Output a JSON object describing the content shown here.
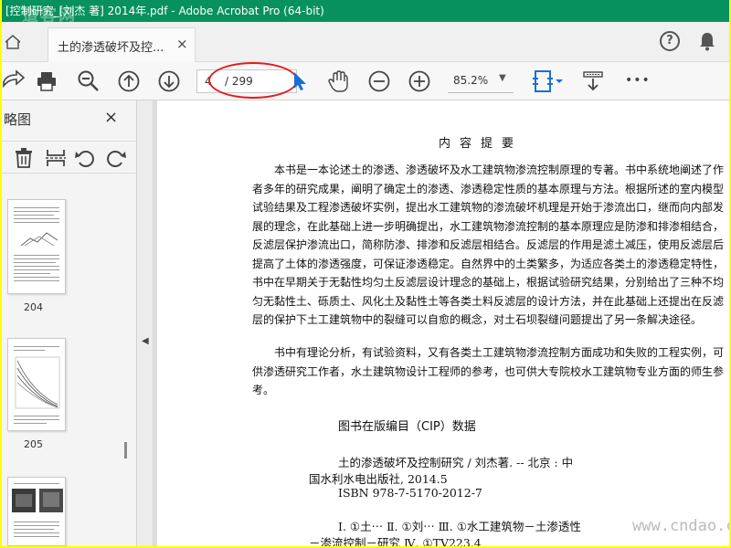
{
  "window": {
    "title": "[控制研究_[刘杰 著] 2014年.pdf - Adobe Acrobat Pro (64-bit)",
    "watermark_top": "道客网"
  },
  "tabbar": {
    "doc_tab_label": "土的渗透破坏及控...",
    "close_glyph": "×",
    "help_glyph": "?"
  },
  "toolbar": {
    "current_page": "4",
    "total_pages": "/ 299",
    "zoom": "85.2%",
    "more_glyph": "•••"
  },
  "sidebar": {
    "title": "略图",
    "close_glyph": "×",
    "thumbnails": [
      {
        "label": "204"
      },
      {
        "label": "205"
      },
      {
        "label": ""
      }
    ]
  },
  "document": {
    "summary_title": "内容提要",
    "para1": "本书是一本论述土的渗透、渗透破坏及水工建筑物渗流控制原理的专著。书中系统地阐述了作者多年的研究成果，阐明了确定土的渗透、渗透稳定性质的基本原理与方法。根据所述的室内模型试验结果及工程渗透破坏实例，提出水工建筑物的渗流破坏机理是开始于渗流出口，继而向内部发展的理念，在此基础上进一步明确提出，水工建筑物渗流控制的基本原理应是防渗和排渗相结合，反滤层保护渗流出口，简称防渗、排渗和反滤层相结合。反滤层的作用是滤土减压，使用反滤层后提高了土体的渗透强度，可保证渗透稳定。自然界中的土类繁多，为适应各类土的渗透稳定特性，书中在早期关于无黏性均匀土反滤层设计理念的基础上，根据试验研究结果，分别给出了三种不均匀无黏性土、砾质土、风化土及黏性土等各类土料反滤层的设计方法，并在此基础上还提出在反滤层的保护下土工建筑物中的裂缝可以自愈的概念，对土石坝裂缝问题提出了另一条解决途径。",
    "para2": "书中有理论分析，有试验资料，又有各类土工建筑物渗流控制方面成功和失败的工程实例，可供渗透研究工作者，水土建筑物设计工程师的参考，也可供大专院校水工建筑物专业方面的师生参考。",
    "cip_title": "图书在版编目（CIP）数据",
    "cip_line1": "土的渗透破坏及控制研究 / 刘杰著. -- 北京 : 中",
    "cip_line2": "国水利水电出版社, 2014.5",
    "cip_line3": "ISBN 978-7-5170-2012-7",
    "cip_line4": "Ⅰ. ①土⋯ Ⅱ. ①刘⋯ Ⅲ. ①水工建筑物－土渗透性",
    "cip_line5": "－渗流控制－研究 Ⅳ. ①TV223.4"
  },
  "overlay": {
    "watermark_bottom": "www.cndao.com"
  },
  "colors": {
    "titlebar": "#07915e",
    "annotation_red": "#e21b1b",
    "accent_blue": "#1a6fd1",
    "outer_border": "#ffff00"
  }
}
